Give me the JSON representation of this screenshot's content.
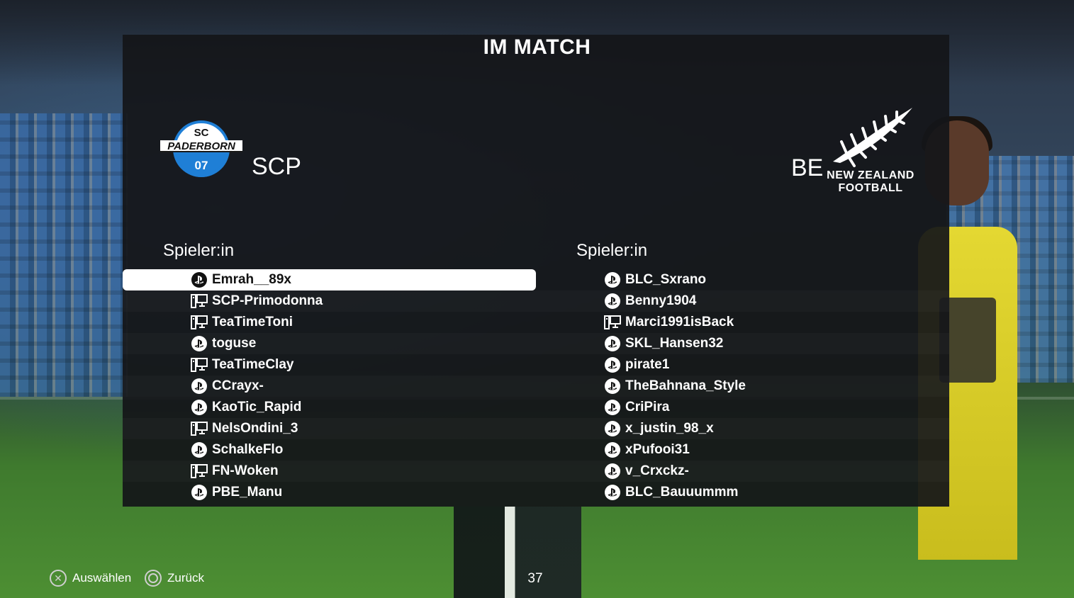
{
  "screen_title": "IM MATCH",
  "home_team": {
    "abbreviation": "SCP",
    "crest_text_top": "SC",
    "crest_text_mid": "PADERBORN",
    "crest_text_num": "07",
    "column_heading": "Spieler:in",
    "players": [
      {
        "name": "Emrah__89x",
        "platform": "playstation",
        "selected": true
      },
      {
        "name": "SCP-Primodonna",
        "platform": "pc"
      },
      {
        "name": "TeaTimeToni",
        "platform": "pc"
      },
      {
        "name": "toguse",
        "platform": "playstation"
      },
      {
        "name": "TeaTimeClay",
        "platform": "pc"
      },
      {
        "name": "CCrayx-",
        "platform": "playstation"
      },
      {
        "name": "KaoTic_Rapid",
        "platform": "playstation"
      },
      {
        "name": "NelsOndini_3",
        "platform": "pc"
      },
      {
        "name": "SchalkeFlo",
        "platform": "playstation"
      },
      {
        "name": "FN-Woken",
        "platform": "pc"
      },
      {
        "name": "PBE_Manu",
        "platform": "playstation"
      }
    ]
  },
  "away_team": {
    "abbreviation": "BE",
    "logo_line1": "NEW ZEALAND",
    "logo_line2": "FOOTBALL",
    "column_heading": "Spieler:in",
    "players": [
      {
        "name": "BLC_Sxrano",
        "platform": "playstation"
      },
      {
        "name": "Benny1904",
        "platform": "playstation"
      },
      {
        "name": "Marci1991isBack",
        "platform": "pc"
      },
      {
        "name": "SKL_Hansen32",
        "platform": "playstation"
      },
      {
        "name": "pirate1",
        "platform": "playstation"
      },
      {
        "name": "TheBahnana_Style",
        "platform": "playstation"
      },
      {
        "name": "CriPira",
        "platform": "playstation"
      },
      {
        "name": "x_justin_98_x",
        "platform": "playstation"
      },
      {
        "name": "xPufooi31",
        "platform": "playstation"
      },
      {
        "name": "v_Crxckz-",
        "platform": "playstation"
      },
      {
        "name": "BLC_Bauuummm",
        "platform": "playstation"
      }
    ]
  },
  "footer": {
    "select_label": "Auswählen",
    "back_label": "Zurück",
    "timer": "37"
  },
  "colors": {
    "panel_bg": "#141619",
    "selected_row_bg": "#ffffff",
    "crest_blue": "#1f7fd6"
  },
  "icons": {
    "playstation": "playstation-icon",
    "pc": "pc-icon",
    "select_button": "cross-button-icon",
    "back_button": "circle-button-icon"
  }
}
